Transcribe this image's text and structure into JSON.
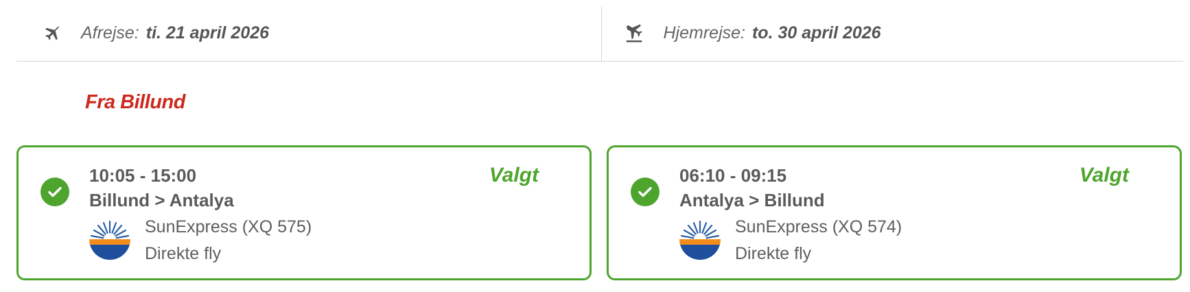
{
  "header": {
    "departure": {
      "label": "Afrejse:",
      "date": "ti. 21 april 2026",
      "icon": "plane-takeoff-icon"
    },
    "return": {
      "label": "Hjemrejse:",
      "date": "to. 30 april 2026",
      "icon": "plane-landing-icon"
    }
  },
  "section": {
    "title": "Fra Billund"
  },
  "colors": {
    "accent_green": "#4ea52e",
    "title_red": "#cc2a1f",
    "text_gray": "#555555"
  },
  "flights": [
    {
      "times": "10:05 - 15:00",
      "route": "Billund > Antalya",
      "airline": "SunExpress (XQ 575)",
      "stops": "Direkte fly",
      "status": "Valgt",
      "icon": "check-circle-icon"
    },
    {
      "times": "06:10 - 09:15",
      "route": "Antalya > Billund",
      "airline": "SunExpress (XQ 574)",
      "stops": "Direkte fly",
      "status": "Valgt",
      "icon": "check-circle-icon"
    }
  ]
}
